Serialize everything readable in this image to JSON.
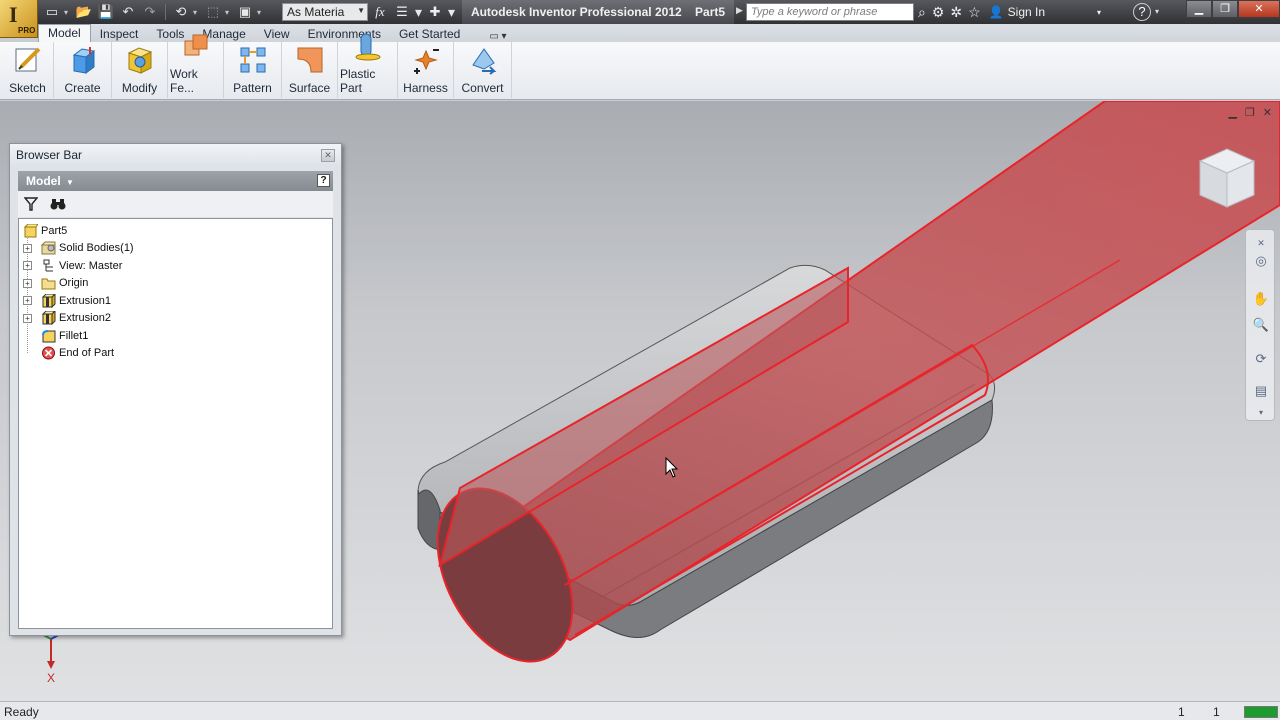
{
  "app": {
    "title": "Autodesk Inventor Professional 2012",
    "document": "Part5",
    "logo_text": "I",
    "logo_badge": "PRO"
  },
  "quick_access": {
    "material": "As Materia",
    "fx_symbol": "fx"
  },
  "search": {
    "placeholder": "Type a keyword or phrase"
  },
  "infocenter": {
    "signin": "Sign In"
  },
  "ribbon": {
    "tabs": [
      {
        "label": "Model",
        "active": true
      },
      {
        "label": "Inspect"
      },
      {
        "label": "Tools"
      },
      {
        "label": "Manage"
      },
      {
        "label": "View"
      },
      {
        "label": "Environments"
      },
      {
        "label": "Get Started"
      }
    ],
    "buttons": [
      {
        "label": "Sketch",
        "icon": "sketch-icon"
      },
      {
        "label": "Create",
        "icon": "create-icon"
      },
      {
        "label": "Modify",
        "icon": "modify-icon"
      },
      {
        "label": "Work Fe...",
        "icon": "work-features-icon"
      },
      {
        "label": "Pattern",
        "icon": "pattern-icon"
      },
      {
        "label": "Surface",
        "icon": "surface-icon"
      },
      {
        "label": "Plastic Part",
        "icon": "plastic-part-icon"
      },
      {
        "label": "Harness",
        "icon": "harness-icon"
      },
      {
        "label": "Convert",
        "icon": "convert-icon"
      }
    ]
  },
  "browser": {
    "title": "Browser Bar",
    "header": "Model",
    "help": "?",
    "tree": [
      {
        "label": "Part5",
        "icon": "part-icon",
        "expandable": false,
        "level": 0
      },
      {
        "label": "Solid Bodies(1)",
        "icon": "solid-bodies-icon",
        "expandable": true,
        "level": 1
      },
      {
        "label": "View: Master",
        "icon": "view-icon",
        "expandable": true,
        "level": 1
      },
      {
        "label": "Origin",
        "icon": "folder-icon",
        "expandable": true,
        "level": 1
      },
      {
        "label": "Extrusion1",
        "icon": "extrusion-icon",
        "expandable": true,
        "level": 1
      },
      {
        "label": "Extrusion2",
        "icon": "extrusion-icon",
        "expandable": true,
        "level": 1
      },
      {
        "label": "Fillet1",
        "icon": "fillet-icon",
        "expandable": false,
        "level": 1
      },
      {
        "label": "End of Part",
        "icon": "end-of-part-icon",
        "expandable": false,
        "level": 1
      }
    ]
  },
  "triad": {
    "axis_label": "X"
  },
  "status": {
    "text": "Ready",
    "count1": "1",
    "count2": "1",
    "progress": 1.0
  },
  "colors": {
    "highlight": "#e8242b",
    "part_gray": "#8a8c90",
    "status_green": "#1e9b2e"
  }
}
